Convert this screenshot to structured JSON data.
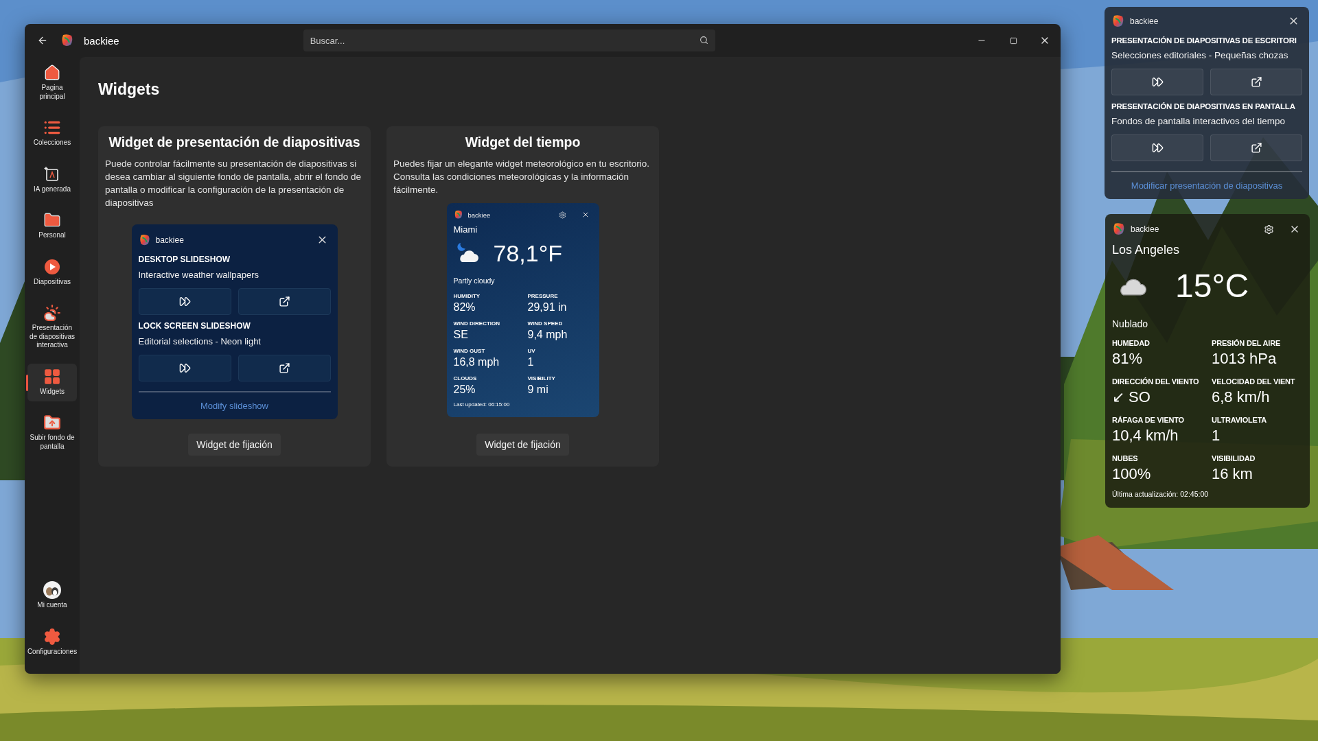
{
  "window": {
    "app_name": "backiee",
    "search": {
      "placeholder": "Buscar..."
    }
  },
  "sidebar": {
    "items": [
      {
        "label": "Pagina principal",
        "selected": false
      },
      {
        "label": "Colecciones",
        "selected": false
      },
      {
        "label": "IA generada",
        "selected": false
      },
      {
        "label": "Personal",
        "selected": false
      },
      {
        "label": "Diapositivas",
        "selected": false
      },
      {
        "label": "Presentación de diapositivas interactiva",
        "selected": false
      },
      {
        "label": "Widgets",
        "selected": true
      },
      {
        "label": "Subir fondo de pantalla",
        "selected": false
      }
    ],
    "bottom_items": [
      {
        "label": "Mi cuenta",
        "selected": false
      },
      {
        "label": "Configuraciones",
        "selected": false
      }
    ]
  },
  "page": {
    "title": "Widgets",
    "cards": [
      {
        "title": "Widget de presentación de diapositivas",
        "description": "Puede controlar fácilmente su presentación de diapositivas si desea cambiar al siguiente fondo de pantalla, abrir el fondo de pantalla o modificar la configuración de la presentación de diapositivas",
        "button": "Widget de fijación",
        "preview": {
          "kind": "slideshow",
          "app": "backiee",
          "sections": [
            {
              "heading": "DESKTOP SLIDESHOW",
              "subtitle": "Interactive weather wallpapers"
            },
            {
              "heading": "LOCK SCREEN SLIDESHOW",
              "subtitle": "Editorial selections - Neon light"
            }
          ],
          "link": "Modify slideshow"
        }
      },
      {
        "title": "Widget del tiempo",
        "description": "Puedes fijar un elegante widget meteorológico en tu escritorio. Consulta las condiciones meteorológicas y la información fácilmente.",
        "button": "Widget de fijación",
        "preview": {
          "kind": "weather",
          "app": "backiee",
          "city": "Miami",
          "temperature": "78,1°F",
          "condition": "Partly cloudy",
          "stats": [
            {
              "label": "HUMIDITY",
              "value": "82%"
            },
            {
              "label": "PRESSURE",
              "value": "29,91 in"
            },
            {
              "label": "WIND DIRECTION",
              "value": "SE"
            },
            {
              "label": "WIND SPEED",
              "value": "9,4 mph"
            },
            {
              "label": "WIND GUST",
              "value": "16,8 mph"
            },
            {
              "label": "UV",
              "value": "1"
            },
            {
              "label": "CLOUDS",
              "value": "25%"
            },
            {
              "label": "VISIBILITY",
              "value": "9 mi"
            }
          ],
          "updated": "Last updated: 06:15:00"
        }
      }
    ]
  },
  "desktop_widgets": [
    {
      "kind": "slideshow",
      "app": "backiee",
      "sections": [
        {
          "heading": "PRESENTACIÓN DE DIAPOSITIVAS DE ESCRITORI",
          "subtitle": "Selecciones editoriales - Pequeñas chozas"
        },
        {
          "heading": "PRESENTACIÓN DE DIAPOSITIVAS EN PANTALLA",
          "subtitle": "Fondos de pantalla interactivos del tiempo"
        }
      ],
      "link": "Modificar presentación de diapositivas"
    },
    {
      "kind": "weather",
      "app": "backiee",
      "city": "Los Angeles",
      "temperature": "15°C",
      "condition": "Nublado",
      "stats": [
        {
          "label": "HUMEDAD",
          "value": "81%"
        },
        {
          "label": "PRESIÓN DEL AIRE",
          "value": "1013 hPa"
        },
        {
          "label": "DIRECCIÓN DEL VIENTO",
          "value": "↙ SO"
        },
        {
          "label": "VELOCIDAD DEL VIENT",
          "value": "6,8 km/h"
        },
        {
          "label": "RÁFAGA DE VIENTO",
          "value": "10,4 km/h"
        },
        {
          "label": "ULTRAVIOLETA",
          "value": "1"
        },
        {
          "label": "NUBES",
          "value": "100%"
        },
        {
          "label": "VISIBILIDAD",
          "value": "16 km"
        }
      ],
      "updated": "Última actualización: 02:45:00"
    }
  ]
}
